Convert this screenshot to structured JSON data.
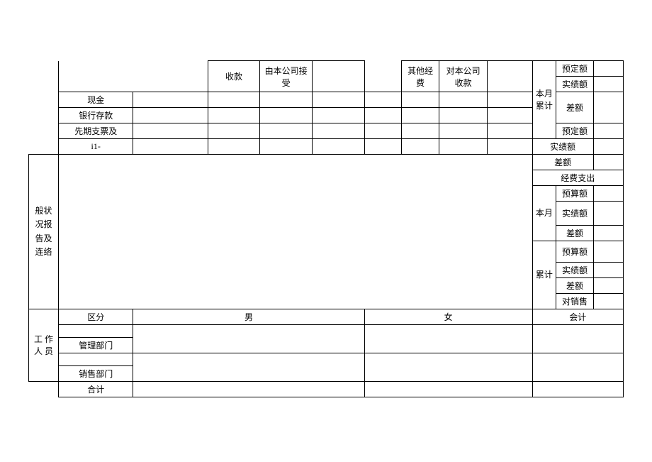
{
  "top": {
    "col_receipt": "收款",
    "col_company_accept": "由本公司接受",
    "col_other_expense": "其他经费",
    "col_company_receipt": "对本公司收款",
    "row_cash": "现金",
    "row_bank": "银行存款",
    "row_prior": "先期支票及",
    "row_i1": "i1-"
  },
  "side": {
    "this_month_total": "本月累计",
    "planned": "预定额",
    "actual": "实绩额",
    "diff": "差额",
    "expense_out": "经费支出",
    "this_month": "本月",
    "budget": "预算额",
    "cumulative": "累计",
    "vs_sales": "对销售"
  },
  "mid": {
    "status_report": "般状况报告及连络"
  },
  "staff": {
    "label": "工 作人 员",
    "category": "区分",
    "male": "男",
    "female": "女",
    "accounting": "会计",
    "mgmt": "管理部门",
    "sales": "销售部门",
    "total": "合计"
  }
}
